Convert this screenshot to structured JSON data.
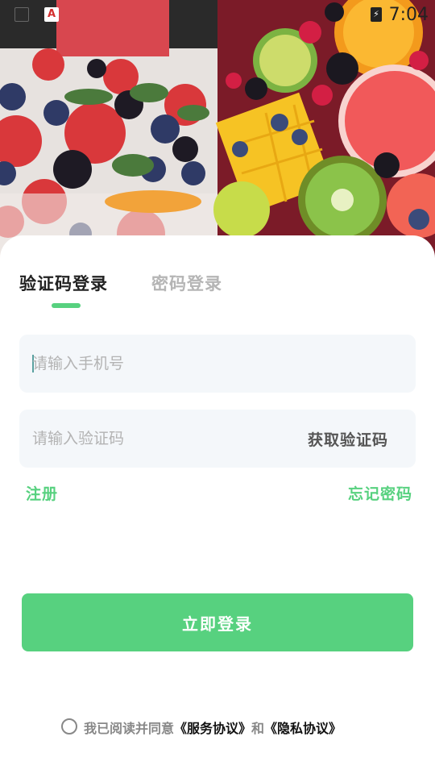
{
  "status_bar": {
    "time": "7:04",
    "left_icons": [
      "image-icon",
      "a-app-icon"
    ],
    "right_icons": [
      "battery-charging-icon"
    ]
  },
  "tabs": [
    {
      "label": "验证码登录",
      "active": true
    },
    {
      "label": "密码登录",
      "active": false
    }
  ],
  "phone": {
    "placeholder": "请输入手机号",
    "value": ""
  },
  "code": {
    "placeholder": "请输入验证码",
    "value": "",
    "get_code_label": "获取验证码"
  },
  "links": {
    "register": "注册",
    "forgot": "忘记密码"
  },
  "login_button": "立即登录",
  "agreement": {
    "prefix": "我已阅读并同意",
    "service": "《服务协议》",
    "and": "和",
    "privacy": "《隐私协议》",
    "checked": false
  },
  "colors": {
    "accent": "#57d17f",
    "field_bg": "#f4f7fa",
    "placeholder": "#b3b3b3"
  }
}
